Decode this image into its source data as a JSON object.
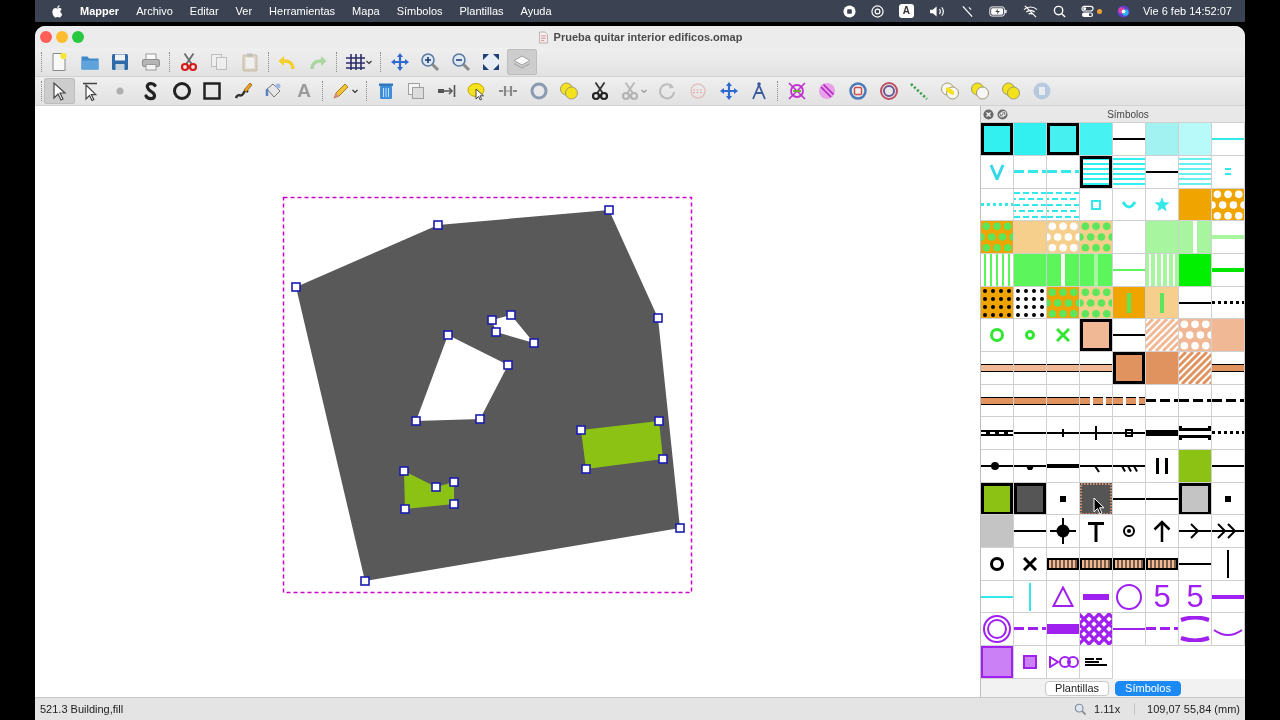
{
  "menu_bar": {
    "app_name": "Mapper",
    "menus": [
      "Archivo",
      "Editar",
      "Ver",
      "Herramientas",
      "Mapa",
      "Símbolos",
      "Plantillas",
      "Ayuda"
    ],
    "input_source": "A",
    "clock": "Vie 6 feb 14:52:07"
  },
  "window": {
    "title": "Prueba quitar interior edificos.omap"
  },
  "toolbars": [
    {
      "groups": [
        [
          {
            "disabled": false,
            "selected": false
          },
          {
            "disabled": false,
            "selected": false
          },
          {
            "disabled": false,
            "selected": false
          },
          {
            "disabled": false,
            "selected": false
          }
        ],
        [
          {
            "disabled": false,
            "selected": false
          },
          {
            "disabled": true,
            "selected": false
          },
          {
            "disabled": true,
            "selected": false
          }
        ],
        [
          {
            "disabled": false,
            "selected": false
          },
          {
            "disabled": true,
            "selected": false
          }
        ],
        [
          {
            "disabled": false,
            "selected": false
          }
        ],
        [
          {
            "disabled": false,
            "selected": false
          },
          {
            "disabled": false,
            "selected": false
          },
          {
            "disabled": false,
            "selected": false
          },
          {
            "disabled": false,
            "selected": false
          },
          {
            "disabled": false,
            "selected": true
          }
        ]
      ]
    },
    {
      "groups": [
        [
          {
            "disabled": false,
            "selected": true
          },
          {
            "disabled": false,
            "selected": false
          },
          {
            "disabled": true,
            "selected": false
          },
          {
            "disabled": false,
            "selected": false
          },
          {
            "disabled": false,
            "selected": false
          },
          {
            "disabled": false,
            "selected": false
          },
          {
            "disabled": false,
            "selected": false
          },
          {
            "disabled": false,
            "selected": false
          },
          {
            "label": "A",
            "disabled": true,
            "selected": false
          }
        ],
        [
          {
            "disabled": false,
            "selected": false
          }
        ],
        [
          {
            "disabled": false,
            "selected": false
          },
          {
            "disabled": false,
            "selected": false
          },
          {
            "disabled": false,
            "selected": false
          },
          {
            "disabled": false,
            "selected": false
          },
          {
            "disabled": false,
            "selected": false
          },
          {
            "disabled": false,
            "selected": false
          },
          {
            "disabled": false,
            "selected": false
          },
          {
            "disabled": false,
            "selected": false
          },
          {
            "disabled": true,
            "selected": false
          },
          {
            "disabled": true,
            "selected": false
          },
          {
            "disabled": true,
            "selected": false
          },
          {
            "disabled": false,
            "selected": false
          },
          {
            "disabled": false,
            "selected": false
          }
        ],
        [
          {
            "disabled": false,
            "selected": false
          },
          {
            "disabled": false,
            "selected": false
          },
          {
            "disabled": false,
            "selected": false
          },
          {
            "disabled": false,
            "selected": false
          },
          {
            "disabled": false,
            "selected": false
          },
          {
            "disabled": false,
            "selected": false
          },
          {
            "disabled": false,
            "selected": false
          },
          {
            "disabled": false,
            "selected": false
          },
          {
            "disabled": true,
            "selected": false
          }
        ]
      ]
    }
  ],
  "symbol_panel": {
    "title": "Símbolos",
    "symbols": [
      {
        "kind": "framed-fill",
        "color": "#33f0f0",
        "selected": false
      },
      {
        "kind": "fill",
        "color": "#33f0f0",
        "selected": false
      },
      {
        "kind": "framed-fill",
        "color": "#47f0f0",
        "selected": false
      },
      {
        "kind": "fill",
        "color": "#47f2f2",
        "selected": false
      },
      {
        "kind": "line",
        "color": "#000000",
        "selected": false
      },
      {
        "kind": "fill",
        "color": "#a3f2f2",
        "selected": false
      },
      {
        "kind": "fill",
        "color": "#b8fafa",
        "selected": false
      },
      {
        "kind": "line",
        "color": "#33e8e8",
        "selected": false
      },
      {
        "kind": "v-mark",
        "color": "#33d9e6",
        "selected": false
      },
      {
        "kind": "dashed-line",
        "color": "#33e8e8",
        "selected": false
      },
      {
        "kind": "dashed-line",
        "color": "#33e8e8",
        "selected": false
      },
      {
        "kind": "framed-h-stripes",
        "color": "#33f0f0",
        "selected": false
      },
      {
        "kind": "h-stripes",
        "color": "#33f0f0",
        "selected": false
      },
      {
        "kind": "line",
        "color": "#000000",
        "selected": false
      },
      {
        "kind": "h-stripes",
        "color": "#66f0f0",
        "selected": false
      },
      {
        "kind": "double-dash",
        "color": "#33e8e8",
        "selected": false
      },
      {
        "kind": "dotted-line",
        "color": "#33e8e8",
        "selected": false
      },
      {
        "kind": "dash-pattern",
        "color": "#33e8e8",
        "selected": false
      },
      {
        "kind": "dash-pattern",
        "color": "#33e8e8",
        "selected": false
      },
      {
        "kind": "square-mark",
        "color": "#33e8e8",
        "selected": false
      },
      {
        "kind": "arc-mark",
        "color": "#33e8e8",
        "selected": false
      },
      {
        "kind": "star-mark",
        "color": "#33e8e8",
        "selected": false
      },
      {
        "kind": "fill",
        "color": "#f0a400",
        "selected": false
      },
      {
        "kind": "dots",
        "color": "#f0a400",
        "pattern": {
          "color": "#ffffff"
        },
        "selected": false
      },
      {
        "kind": "dots",
        "color": "#f0a400",
        "pattern": {
          "color": "#5ce65c"
        },
        "selected": false
      },
      {
        "kind": "fill",
        "color": "#f7cf8c",
        "selected": false
      },
      {
        "kind": "dots",
        "color": "#f7cf8c",
        "pattern": {
          "color": "#ffffff"
        },
        "selected": false
      },
      {
        "kind": "dots",
        "color": "#f7cf8c",
        "pattern": {
          "color": "#5ce65c"
        },
        "selected": false
      },
      {
        "kind": "blank",
        "selected": false
      },
      {
        "kind": "fill",
        "color": "#a8f5a0",
        "selected": false
      },
      {
        "kind": "v-bar",
        "color": "#a8f5a0",
        "pattern": {
          "color": "#ffffff"
        },
        "selected": false
      },
      {
        "kind": "thick-line",
        "color": "#a8f5a0",
        "selected": false
      },
      {
        "kind": "v-stripes",
        "color": "#ffffff",
        "pattern": {
          "color": "#5cf55c"
        },
        "selected": false
      },
      {
        "kind": "fill",
        "color": "#5cf55c",
        "selected": false
      },
      {
        "kind": "v-bar",
        "color": "#5cf55c",
        "pattern": {
          "color": "#ffffff"
        },
        "selected": false
      },
      {
        "kind": "v-bar",
        "color": "#5cf55c",
        "pattern": {
          "color": "#a8f5a0"
        },
        "selected": false
      },
      {
        "kind": "line",
        "color": "#5cf55c",
        "selected": false
      },
      {
        "kind": "v-stripes",
        "color": "#a8f5a0",
        "pattern": {
          "color": "#ffffff"
        },
        "selected": false
      },
      {
        "kind": "fill",
        "color": "#00f000",
        "selected": false
      },
      {
        "kind": "thick-line",
        "color": "#00e600",
        "selected": false
      },
      {
        "kind": "small-dots",
        "color": "#f0a400",
        "pattern": {
          "color": "#000000"
        },
        "selected": false
      },
      {
        "kind": "small-dots",
        "color": "#ffffff",
        "pattern": {
          "color": "#000000"
        },
        "selected": false
      },
      {
        "kind": "dots",
        "color": "#f0a400",
        "pattern": {
          "color": "#5ce65c"
        },
        "selected": false
      },
      {
        "kind": "dots",
        "color": "#f7cf8c",
        "pattern": {
          "color": "#5ce65c"
        },
        "selected": false
      },
      {
        "kind": "short-v-bar",
        "color": "#f0a400",
        "pattern": {
          "color": "#5ce65c"
        },
        "selected": false
      },
      {
        "kind": "short-v-bar",
        "color": "#f7cf8c",
        "pattern": {
          "color": "#5ce65c"
        },
        "selected": false
      },
      {
        "kind": "line",
        "color": "#000000",
        "selected": false
      },
      {
        "kind": "dotted-line",
        "color": "#000000",
        "selected": false
      },
      {
        "kind": "ring-mark",
        "color": "#33e633",
        "selected": false
      },
      {
        "kind": "small-ring",
        "color": "#33e633",
        "selected": false
      },
      {
        "kind": "cross-mark",
        "color": "#33e633",
        "selected": false
      },
      {
        "kind": "framed-fill",
        "color": "#f0b894",
        "selected": false
      },
      {
        "kind": "line",
        "color": "#000000",
        "selected": false
      },
      {
        "kind": "diag-stripes",
        "color": "#f0b894",
        "selected": false
      },
      {
        "kind": "dots",
        "color": "#f0b894",
        "pattern": {
          "color": "#ffffff"
        },
        "selected": false
      },
      {
        "kind": "fill",
        "color": "#f0b894",
        "selected": false
      },
      {
        "kind": "road",
        "color": "#f0b894",
        "selected": false
      },
      {
        "kind": "road",
        "color": "#f0b894",
        "selected": false
      },
      {
        "kind": "road",
        "color": "#f0b894",
        "selected": false
      },
      {
        "kind": "road",
        "color": "#f0b894",
        "selected": false
      },
      {
        "kind": "framed-fill",
        "color": "#e0935e",
        "selected": false
      },
      {
        "kind": "fill",
        "color": "#e0935e",
        "selected": false
      },
      {
        "kind": "diag-stripes",
        "color": "#e0935e",
        "selected": false
      },
      {
        "kind": "road",
        "color": "#e0935e",
        "selected": false
      },
      {
        "kind": "road",
        "color": "#e0935e",
        "selected": false
      },
      {
        "kind": "road",
        "color": "#e0935e",
        "selected": false
      },
      {
        "kind": "road",
        "color": "#e0935e",
        "selected": false
      },
      {
        "kind": "dashed-road",
        "color": "#e0935e",
        "selected": false
      },
      {
        "kind": "dashed-road",
        "color": "#e0935e",
        "selected": false
      },
      {
        "kind": "dashed-line",
        "color": "#000000",
        "selected": false
      },
      {
        "kind": "dashed-line",
        "color": "#000000",
        "selected": false
      },
      {
        "kind": "dashed-line",
        "color": "#000000",
        "selected": false
      },
      {
        "kind": "rail",
        "color": "#000000",
        "selected": false
      },
      {
        "kind": "line",
        "color": "#000000",
        "selected": false
      },
      {
        "kind": "tick-line",
        "color": "#000000",
        "selected": false
      },
      {
        "kind": "tall-tick-line",
        "color": "#000000",
        "selected": false
      },
      {
        "kind": "square-line",
        "color": "#000000",
        "selected": false
      },
      {
        "kind": "wall",
        "color": "#000000",
        "selected": false
      },
      {
        "kind": "bridge",
        "color": "#000000",
        "selected": false
      },
      {
        "kind": "dotted-line",
        "color": "#000000",
        "selected": false
      },
      {
        "kind": "dot-line",
        "color": "#000000",
        "selected": false
      },
      {
        "kind": "bump-line",
        "color": "#000000",
        "selected": false
      },
      {
        "kind": "thick-line",
        "color": "#000000",
        "selected": false
      },
      {
        "kind": "slash-line",
        "color": "#000000",
        "selected": false
      },
      {
        "kind": "slashes-line",
        "color": "#000000",
        "selected": false
      },
      {
        "kind": "double-bar",
        "color": "#000000",
        "selected": false
      },
      {
        "kind": "fill",
        "color": "#8cc214",
        "selected": false
      },
      {
        "kind": "line",
        "color": "#000000",
        "selected": false
      },
      {
        "kind": "framed-fill",
        "color": "#8cc214",
        "selected": false
      },
      {
        "kind": "framed-fill",
        "color": "#555555",
        "selected": false
      },
      {
        "kind": "dot-mark",
        "color": "#000000",
        "selected": false
      },
      {
        "kind": "fill",
        "color": "#555555",
        "selected": true
      },
      {
        "kind": "line",
        "color": "#000000",
        "selected": false
      },
      {
        "kind": "line",
        "color": "#000000",
        "selected": false
      },
      {
        "kind": "framed-fill",
        "color": "#c4c4c4",
        "selected": false
      },
      {
        "kind": "dot-mark",
        "color": "#000000",
        "selected": false
      },
      {
        "kind": "fill",
        "color": "#c4c4c4",
        "selected": false
      },
      {
        "kind": "line",
        "color": "#000000",
        "selected": false
      },
      {
        "kind": "crosshair",
        "color": "#000000",
        "selected": false
      },
      {
        "kind": "t-mark",
        "color": "#000000",
        "selected": false
      },
      {
        "kind": "ring-dot",
        "color": "#000000",
        "selected": false
      },
      {
        "kind": "arrow-up",
        "color": "#000000",
        "selected": false
      },
      {
        "kind": "arrow-line",
        "color": "#000000",
        "selected": false
      },
      {
        "kind": "double-arrow-line",
        "color": "#000000",
        "selected": false
      },
      {
        "kind": "ring-mark",
        "color": "#000000",
        "selected": false
      },
      {
        "kind": "cross-mark",
        "color": "#000000",
        "selected": false
      },
      {
        "kind": "ladder",
        "color": "#f0b894",
        "selected": false
      },
      {
        "kind": "ladder",
        "color": "#f0b894",
        "selected": false
      },
      {
        "kind": "ladder",
        "color": "#f0b894",
        "selected": false
      },
      {
        "kind": "ladder",
        "color": "#f0b894",
        "selected": false
      },
      {
        "kind": "line",
        "color": "#000000",
        "selected": false
      },
      {
        "kind": "v-line",
        "color": "#000000",
        "selected": false
      },
      {
        "kind": "line",
        "color": "#33e8e8",
        "selected": false
      },
      {
        "kind": "v-line",
        "color": "#33e8e8",
        "selected": false
      },
      {
        "kind": "triangle-mark",
        "color": "#a020f0",
        "selected": false
      },
      {
        "kind": "short-bar",
        "color": "#a020f0",
        "selected": false
      },
      {
        "kind": "circle-mark",
        "color": "#a020f0",
        "selected": false
      },
      {
        "kind": "text",
        "color": "#a020f0",
        "text": "5",
        "selected": false
      },
      {
        "kind": "text",
        "color": "#a020f0",
        "text": "5",
        "selected": false
      },
      {
        "kind": "thick-line",
        "color": "#a020f0",
        "selected": false
      },
      {
        "kind": "double-circle",
        "color": "#a020f0",
        "selected": false
      },
      {
        "kind": "dashed-line",
        "color": "#a020f0",
        "selected": false
      },
      {
        "kind": "band",
        "color": "#a020f0",
        "selected": false
      },
      {
        "kind": "crosshatch",
        "color": "#a020f0",
        "selected": false
      },
      {
        "kind": "line",
        "color": "#a020f0",
        "selected": false
      },
      {
        "kind": "dashed-line",
        "color": "#a020f0",
        "selected": false
      },
      {
        "kind": "brackets",
        "color": "#a020f0",
        "selected": false
      },
      {
        "kind": "arc-line",
        "color": "#a020f0",
        "selected": false
      },
      {
        "kind": "bordered-fill",
        "color": "#cc80f5",
        "pattern": {
          "color": "#a020f0"
        },
        "selected": false
      },
      {
        "kind": "small-square",
        "color": "#cc80f5",
        "pattern": {
          "color": "#a020f0"
        },
        "selected": false
      },
      {
        "kind": "bow-tie",
        "color": "#a020f0",
        "selected": false
      },
      {
        "kind": "logo",
        "color": "#000000",
        "selected": false
      }
    ],
    "tabs": [
      {
        "label": "Plantillas",
        "selected": false
      },
      {
        "label": "Símbolos",
        "selected": true
      }
    ]
  },
  "status_bar": {
    "object_info": "521.3 Building,fill",
    "zoom": "1.11x",
    "coordinates": "109,07 55,84 (mm)"
  }
}
